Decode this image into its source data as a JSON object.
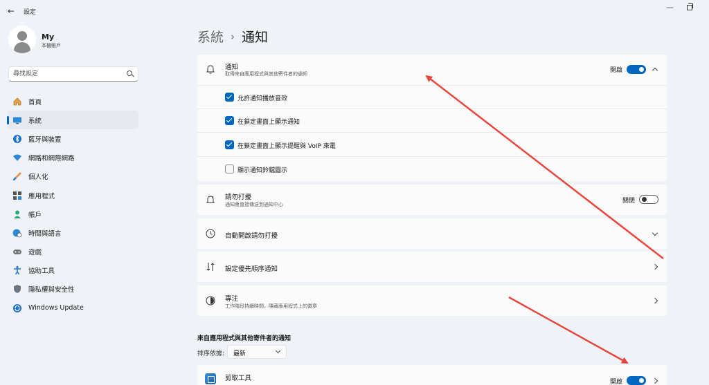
{
  "window": {
    "title": "設定",
    "back_icon": "arrow-left-icon",
    "minimize_icon": "minimize-icon",
    "restore_icon": "restore-icon"
  },
  "profile": {
    "name": "My",
    "subtitle": "本機帳戶"
  },
  "search": {
    "placeholder": "尋找設定",
    "icon": "search-icon"
  },
  "sidebar": {
    "items": [
      {
        "label": "首頁",
        "icon": "home-icon",
        "active": false
      },
      {
        "label": "系統",
        "icon": "display-icon",
        "active": true
      },
      {
        "label": "藍牙與裝置",
        "icon": "bluetooth-icon",
        "active": false
      },
      {
        "label": "網路和網際網路",
        "icon": "wifi-icon",
        "active": false
      },
      {
        "label": "個人化",
        "icon": "brush-icon",
        "active": false
      },
      {
        "label": "應用程式",
        "icon": "apps-icon",
        "active": false
      },
      {
        "label": "帳戶",
        "icon": "account-icon",
        "active": false
      },
      {
        "label": "時間與語言",
        "icon": "globe-clock-icon",
        "active": false
      },
      {
        "label": "遊戲",
        "icon": "gamepad-icon",
        "active": false
      },
      {
        "label": "協助工具",
        "icon": "accessibility-icon",
        "active": false
      },
      {
        "label": "隱私權與安全性",
        "icon": "shield-icon",
        "active": false
      },
      {
        "label": "Windows Update",
        "icon": "update-icon",
        "active": false
      }
    ]
  },
  "breadcrumb": {
    "parent": "系統",
    "separator": "›",
    "current": "通知"
  },
  "notifications": {
    "title": "通知",
    "subtitle": "取得來自應用程式與其他寄件者的通知",
    "toggle_label": "開啟",
    "toggle_on": true,
    "options": [
      {
        "label": "允許通知播放音效",
        "checked": true
      },
      {
        "label": "在鎖定畫面上顯示通知",
        "checked": true
      },
      {
        "label": "在鎖定畫面上顯示提醒與 VoIP 來電",
        "checked": true
      },
      {
        "label": "顯示通知鈴鐺圖示",
        "checked": false
      }
    ]
  },
  "dnd": {
    "title": "請勿打擾",
    "subtitle": "通知會直接傳送到通知中心",
    "toggle_label": "關閉",
    "toggle_on": false
  },
  "auto_dnd": {
    "title": "自動開啟請勿打擾"
  },
  "priority": {
    "title": "設定優先順序通知"
  },
  "focus": {
    "title": "專注",
    "subtitle": "工作階段持續時間，隱藏應用程式上的徽章"
  },
  "app_section": {
    "title": "來自應用程式與其他寄件者的通知",
    "sort_label": "排序依據:",
    "sort_value": "最新"
  },
  "apps": [
    {
      "title": "剪取工具",
      "toggle_label": "開啟",
      "toggle_on": true
    }
  ],
  "annotation_color": "#e8453c"
}
